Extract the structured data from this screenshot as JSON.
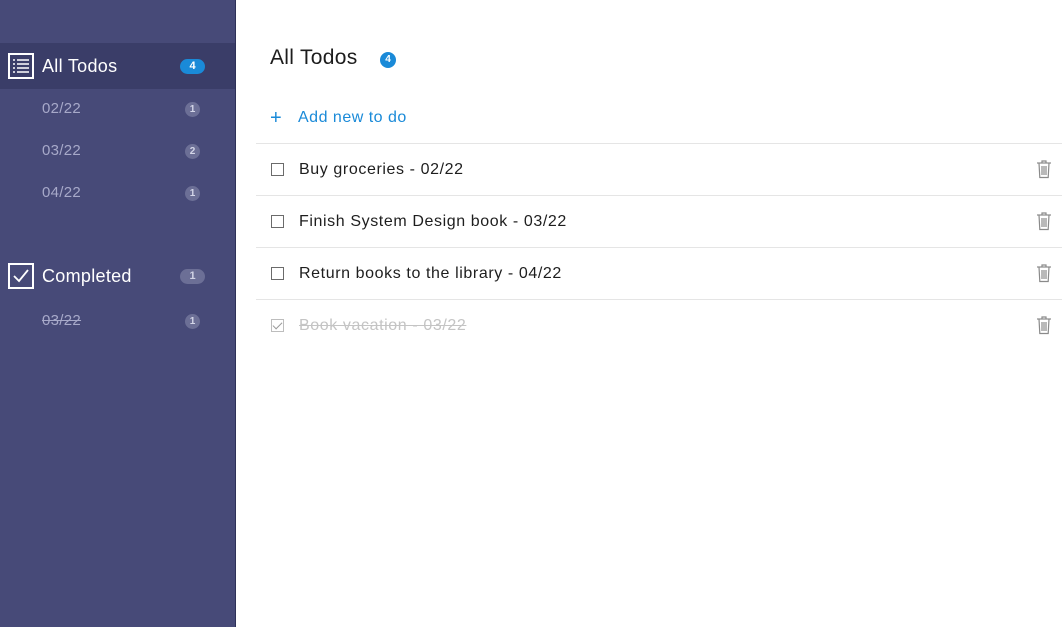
{
  "sidebar": {
    "all": {
      "label": "All Todos",
      "count": "4"
    },
    "all_items": [
      {
        "label": "02/22",
        "count": "1"
      },
      {
        "label": "03/22",
        "count": "2"
      },
      {
        "label": "04/22",
        "count": "1"
      }
    ],
    "completed": {
      "label": "Completed",
      "count": "1"
    },
    "completed_items": [
      {
        "label": "03/22",
        "count": "1"
      }
    ]
  },
  "main": {
    "title": "All Todos",
    "count": "4",
    "add_icon": "+",
    "add_label": "Add new to do",
    "todos": [
      {
        "text": "Buy groceries - 02/22",
        "done": false
      },
      {
        "text": "Finish System Design book - 03/22",
        "done": false
      },
      {
        "text": "Return books to the library - 04/22",
        "done": false
      },
      {
        "text": "Book vacation - 03/22",
        "done": true
      }
    ]
  },
  "colors": {
    "sidebar_bg": "#474a78",
    "sidebar_active": "#3a3d68",
    "accent": "#1a8ad8"
  },
  "icons": {
    "all_todos": "list-icon",
    "completed": "checkbox-checked-icon",
    "delete": "trash-icon",
    "add": "plus-icon"
  }
}
